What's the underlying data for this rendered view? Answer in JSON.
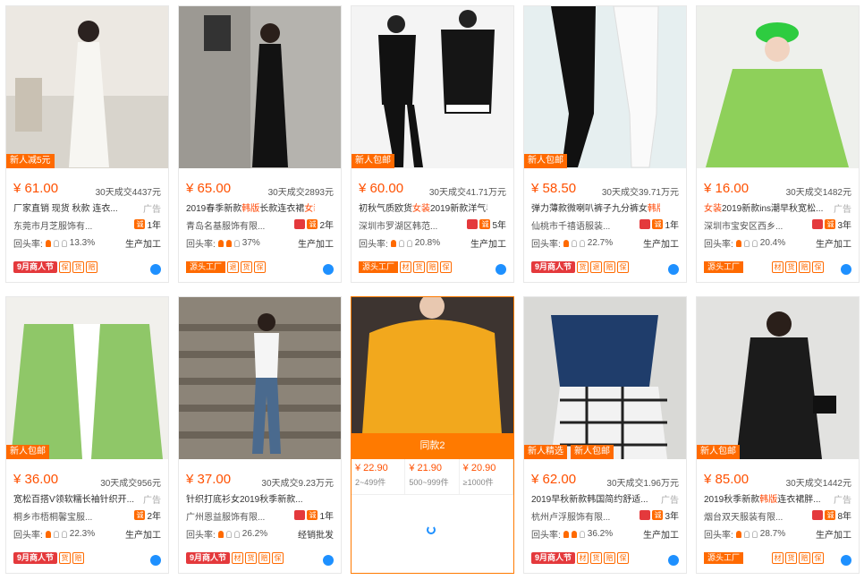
{
  "cards": [
    {
      "tag": "新人减5元",
      "price": "¥ 61.00",
      "sold": "30天成交4437元",
      "title": "厂家直销 现货 秋款 连衣...",
      "ad": "广告",
      "shop": "东莞市月芝服饰有...",
      "years": "1年",
      "rate": "13.3%",
      "mode": "生产加工",
      "badge": "9月商人节"
    },
    {
      "tag": "",
      "price": "¥ 65.00",
      "sold": "30天成交2893元",
      "title_a": "2019春季新款",
      "title_red": "韩版",
      "title_b": "长款连衣裙",
      "title_red2": "女装",
      "ad": "",
      "shop": "青岛名基服饰有限...",
      "years": "2年",
      "rate": "37%",
      "mode": "生产加工",
      "badge": "源头工厂"
    },
    {
      "tag": "新人包邮",
      "price": "¥ 60.00",
      "sold": "30天成交41.71万元",
      "title_a": "初秋气质欧货",
      "title_red": "女装",
      "title_b": "2019新款洋气早...",
      "ad": "",
      "shop": "深圳市罗湖区韩范...",
      "years": "5年",
      "rate": "20.8%",
      "mode": "生产加工",
      "badge": "源头工厂"
    },
    {
      "tag": "新人包邮",
      "price": "¥ 58.50",
      "sold": "30天成交39.71万元",
      "title_a": "弹力薄款微喇叭裤子九分裤女",
      "title_red": "韩版",
      "title_b": "...",
      "ad": "",
      "shop": "仙桃市千禧语服装...",
      "years": "1年",
      "rate": "22.7%",
      "mode": "生产加工",
      "badge": "9月商人节"
    },
    {
      "tag": "",
      "price": "¥ 16.00",
      "sold": "30天成交1482元",
      "title_red": "女装",
      "title_b": "2019新款ins潮早秋宽松...",
      "ad": "广告",
      "shop": "深圳市宝安区西乡...",
      "years": "3年",
      "rate": "20.4%",
      "mode": "生产加工",
      "badge": "源头工厂"
    },
    {
      "tag": "新人包邮",
      "price": "¥ 36.00",
      "sold": "30天成交956元",
      "title": "宽松百搭V领软糯长袖针织开...",
      "ad": "广告",
      "shop": "桐乡市梧桐馨宝服...",
      "years": "2年",
      "rate": "22.3%",
      "mode": "生产加工",
      "badge": "9月商人节"
    },
    {
      "tag": "",
      "price": "¥ 37.00",
      "sold": "30天成交9.23万元",
      "title": "针织打底衫女2019秋季新款...",
      "ad": "",
      "shop": "广州恩益服饰有限...",
      "years": "1年",
      "rate": "26.2%",
      "mode": "经销批发",
      "badge": "9月商人节"
    },
    {
      "same": "同款2",
      "tiers": [
        {
          "p": "¥ 22.90",
          "r": "2~499件"
        },
        {
          "p": "¥ 21.90",
          "r": "500~999件"
        },
        {
          "p": "¥ 20.90",
          "r": "≥1000件"
        }
      ]
    },
    {
      "tag": "新人精选",
      "tag2": "新人包邮",
      "price": "¥ 62.00",
      "sold": "30天成交1.96万元",
      "title": "2019早秋新款韩国简约舒适...",
      "ad": "广告",
      "shop": "杭州卢浮服饰有限...",
      "years": "3年",
      "rate": "36.2%",
      "mode": "生产加工",
      "badge": "9月商人节"
    },
    {
      "tag": "新人包邮",
      "price": "¥ 85.00",
      "sold": "30天成交1442元",
      "title_a": "2019秋季新款",
      "title_red": "韩版",
      "title_b": "连衣裙胖...",
      "ad": "广告",
      "shop": "烟台双天服装有限...",
      "years": "8年",
      "rate": "28.7%",
      "mode": "生产加工",
      "badge": "源头工厂"
    }
  ],
  "labels": {
    "repeat": "回头率:",
    "cheng": "诚"
  }
}
